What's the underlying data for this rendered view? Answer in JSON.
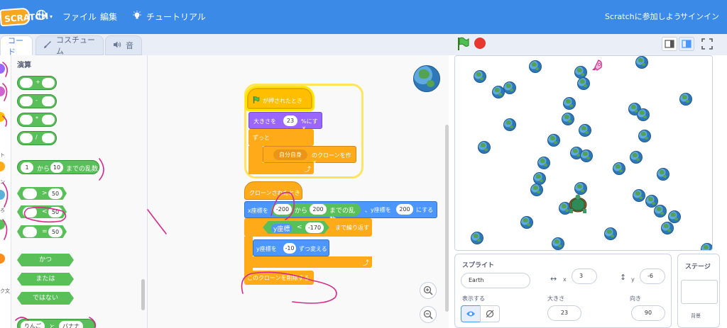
{
  "menu": {
    "logo": "SCRATCH",
    "file": "ファイル",
    "edit": "編集",
    "tutorial": "チュートリアル",
    "join": "Scratchに参加しよう",
    "signin": "サインイン"
  },
  "tabs": {
    "code": "コード",
    "costume": "コスチューム",
    "sound": "音"
  },
  "categories": [
    "ト",
    "ン",
    "ろ",
    "ク文"
  ],
  "palette": {
    "title": "演算",
    "ops": [
      "+",
      "-",
      "*",
      "/"
    ],
    "random": {
      "from": "1",
      "mid": "から",
      "to": "10",
      "suffix": "までの乱数"
    },
    "compare": [
      {
        "sym": ">",
        "val": "50"
      },
      {
        "sym": "<",
        "val": "50"
      },
      {
        "sym": "=",
        "val": "50"
      }
    ],
    "logic": [
      "かつ",
      "または",
      "ではない"
    ],
    "join": {
      "a": "りんご",
      "mid": "と",
      "b": "バナナ"
    }
  },
  "script": {
    "when_flag": "が押されたとき",
    "set_size": {
      "pre": "大きさを",
      "val": "23",
      "post": "%にする"
    },
    "forever": "ずっと",
    "create_clone": {
      "target": "自分自身",
      "post": "のクローンを作る"
    },
    "when_clone": "クローンされたとき",
    "goto": {
      "pre": "x座標を",
      "from": "-200",
      "mid": "から",
      "to": "200",
      "rand": "までの乱数",
      "ypre": "、y座標を",
      "y": "200",
      "post": "にする"
    },
    "repeat_until": {
      "left": "y座標",
      "op": "<",
      "val": "-170",
      "post": "まで繰り返す"
    },
    "change_y": {
      "pre": "y座標を",
      "val": "-10",
      "post": "ずつ変える"
    },
    "delete_clone": "このクローンを削除する"
  },
  "sprite_panel": {
    "title": "スプライト",
    "name": "Earth",
    "x_label": "x",
    "x_value": "3",
    "y_label": "y",
    "y_value": "-6",
    "show_label": "表示する",
    "size_label": "大きさ",
    "size_value": "23",
    "direction_label": "向き",
    "direction_value": "90"
  },
  "stage_panel": {
    "title": "ステージ",
    "backdrop_label": "背景"
  },
  "colors": {
    "menubar": "#3b8ae8",
    "events": "#ffbf00",
    "control": "#ffab19",
    "motion": "#4c97ff",
    "looks": "#9966ff",
    "operators": "#59c059",
    "annotation": "#d62b8c"
  }
}
